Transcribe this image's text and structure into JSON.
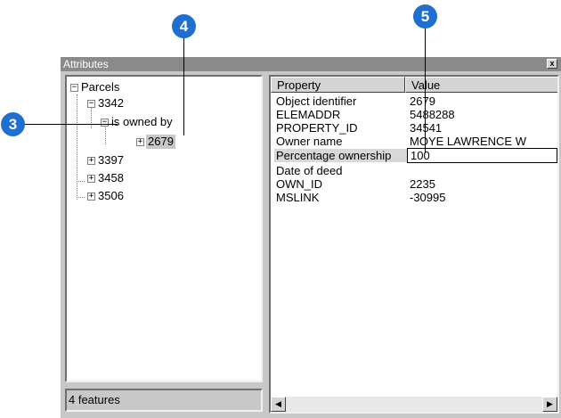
{
  "window": {
    "title": "Attributes",
    "close_label": "x"
  },
  "tree": {
    "root": "Parcels",
    "items": [
      {
        "label": "3342"
      },
      {
        "label": "is owned by"
      },
      {
        "label": "2679"
      },
      {
        "label": "3397"
      },
      {
        "label": "3458"
      },
      {
        "label": "3506"
      }
    ],
    "expand_glyph": "+",
    "collapse_glyph": "−"
  },
  "status": {
    "text": "4 features"
  },
  "table": {
    "headers": {
      "property": "Property",
      "value": "Value"
    },
    "rows": [
      {
        "property": "Object identifier",
        "value": "2679"
      },
      {
        "property": "ELEMADDR",
        "value": "5488288"
      },
      {
        "property": "PROPERTY_ID",
        "value": "34541"
      },
      {
        "property": "Owner name",
        "value": "MOYE LAWRENCE W"
      },
      {
        "property": "Percentage ownership",
        "value": "100"
      },
      {
        "property": "Date of deed",
        "value": ""
      },
      {
        "property": "OWN_ID",
        "value": "2235"
      },
      {
        "property": "MSLINK",
        "value": "-30995"
      }
    ]
  },
  "scrollbar": {
    "left_arrow": "◀",
    "right_arrow": "▶"
  },
  "callouts": {
    "three": "3",
    "four": "4",
    "five": "5"
  },
  "colors": {
    "callout": "#1f6fd0"
  }
}
